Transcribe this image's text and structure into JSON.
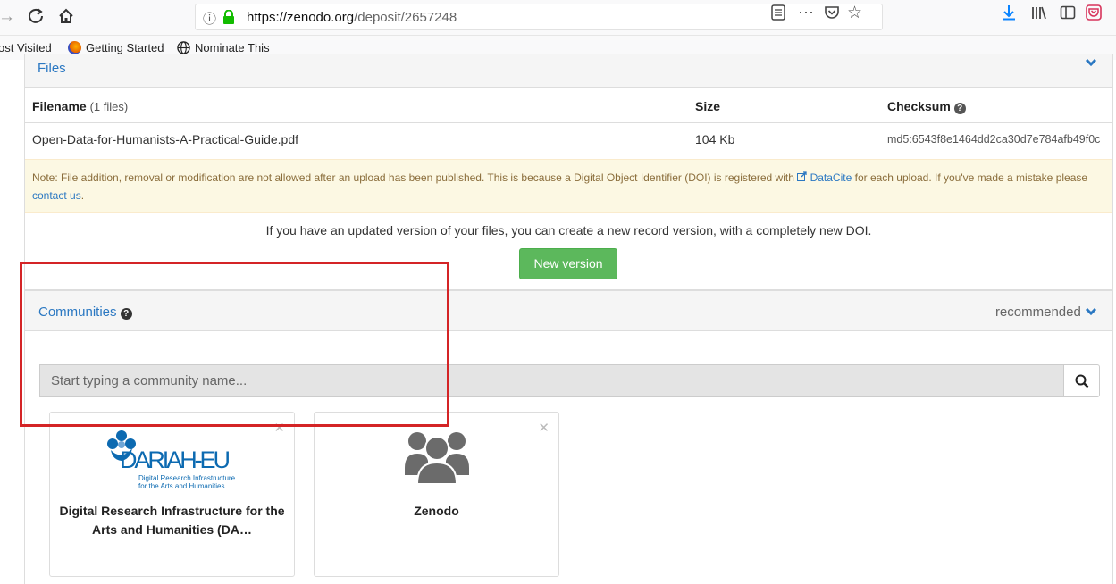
{
  "browser": {
    "url_host": "https://zenodo.org",
    "url_path": "/deposit/2657248",
    "bookmarks": [
      "ost Visited",
      "Getting Started",
      "Nominate This"
    ]
  },
  "files": {
    "title": "Files",
    "col_filename": "Filename",
    "col_filename_count": "(1 files)",
    "col_size": "Size",
    "col_checksum": "Checksum",
    "file_name": "Open-Data-for-Humanists-A-Practical-Guide.pdf",
    "file_size": "104 Kb",
    "file_checksum": "md5:6543f8e1464dd2ca30d7e784afb49f0c",
    "note_text": "Note: File addition, removal or modification are not allowed after an upload has been published. This is because a Digital Object Identifier (DOI) is registered with",
    "note_link": "DataCite",
    "note_text_2": "for each upload. If you've made a mistake please",
    "note_contact": "contact us",
    "version_text": "If you have an updated version of your files, you can create a new record version, with a completely new DOI.",
    "new_version_label": "New version"
  },
  "communities": {
    "title": "Communities",
    "recommended_label": "recommended",
    "search_placeholder": "Start typing a community name...",
    "cards": [
      {
        "logo_text": "DARIAH-EU",
        "logo_sub1": "Digital Research Infrastructure",
        "logo_sub2": "for the Arts and Humanities",
        "title": "Digital Research Infrastructure for the Arts and Humanities (DA…"
      },
      {
        "title": "Zenodo"
      }
    ]
  },
  "colors": {
    "accent": "#2b78c2",
    "success": "#5cb85c",
    "warning_bg": "#fcf8e3",
    "highlight": "#d42426"
  }
}
